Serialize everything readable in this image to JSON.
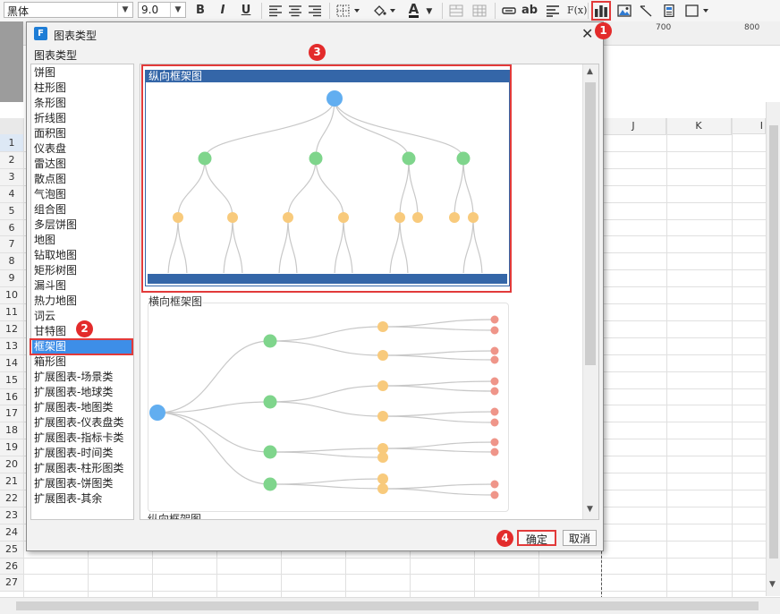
{
  "toolbar": {
    "font_name": "黑体",
    "font_size": "9.0",
    "bold": "B",
    "italic": "I",
    "underline": "U",
    "text_glyph": "ab",
    "formula_glyph": "F(x)",
    "font_color_glyph": "A",
    "accent_color": "#e23a3a",
    "icons": [
      "align-left-icon",
      "align-center-icon",
      "align-right-icon",
      "border-icon",
      "fill-color-icon",
      "font-color-icon",
      "merge-icon",
      "split-icon",
      "link-icon",
      "text-icon",
      "wrap-icon",
      "formula-icon",
      "chart-icon",
      "image-icon",
      "slash-icon",
      "report-icon",
      "frame-icon"
    ]
  },
  "sheet": {
    "ruler_marks": [
      "700",
      "800"
    ],
    "columns": [
      "J",
      "K",
      "I"
    ],
    "rows": [
      "1",
      "2",
      "3",
      "4",
      "5",
      "6",
      "7",
      "8",
      "9",
      "10",
      "11",
      "12",
      "13",
      "14",
      "15",
      "16",
      "17",
      "18",
      "19",
      "20",
      "21",
      "22",
      "23",
      "24",
      "25",
      "26",
      "27"
    ]
  },
  "dialog": {
    "title": "图表类型",
    "section_label": "图表类型",
    "chart_types": [
      "饼图",
      "柱形图",
      "条形图",
      "折线图",
      "面积图",
      "仪表盘",
      "雷达图",
      "散点图",
      "气泡图",
      "组合图",
      "多层饼图",
      "地图",
      "钻取地图",
      "矩形树图",
      "漏斗图",
      "热力地图",
      "词云",
      "甘特图",
      "框架图",
      "箱形图",
      "扩展图表-场景类",
      "扩展图表-地球类",
      "扩展图表-地图类",
      "扩展图表-仪表盘类",
      "扩展图表-指标卡类",
      "扩展图表-时间类",
      "扩展图表-柱形图类",
      "扩展图表-饼图类",
      "扩展图表-其余"
    ],
    "selected_type": "框架图",
    "preview_items": [
      "纵向框架图",
      "横向框架图",
      "纵向框架图"
    ],
    "ok_label": "确定",
    "cancel_label": "取消"
  },
  "badges": [
    "1",
    "2",
    "3",
    "4"
  ]
}
